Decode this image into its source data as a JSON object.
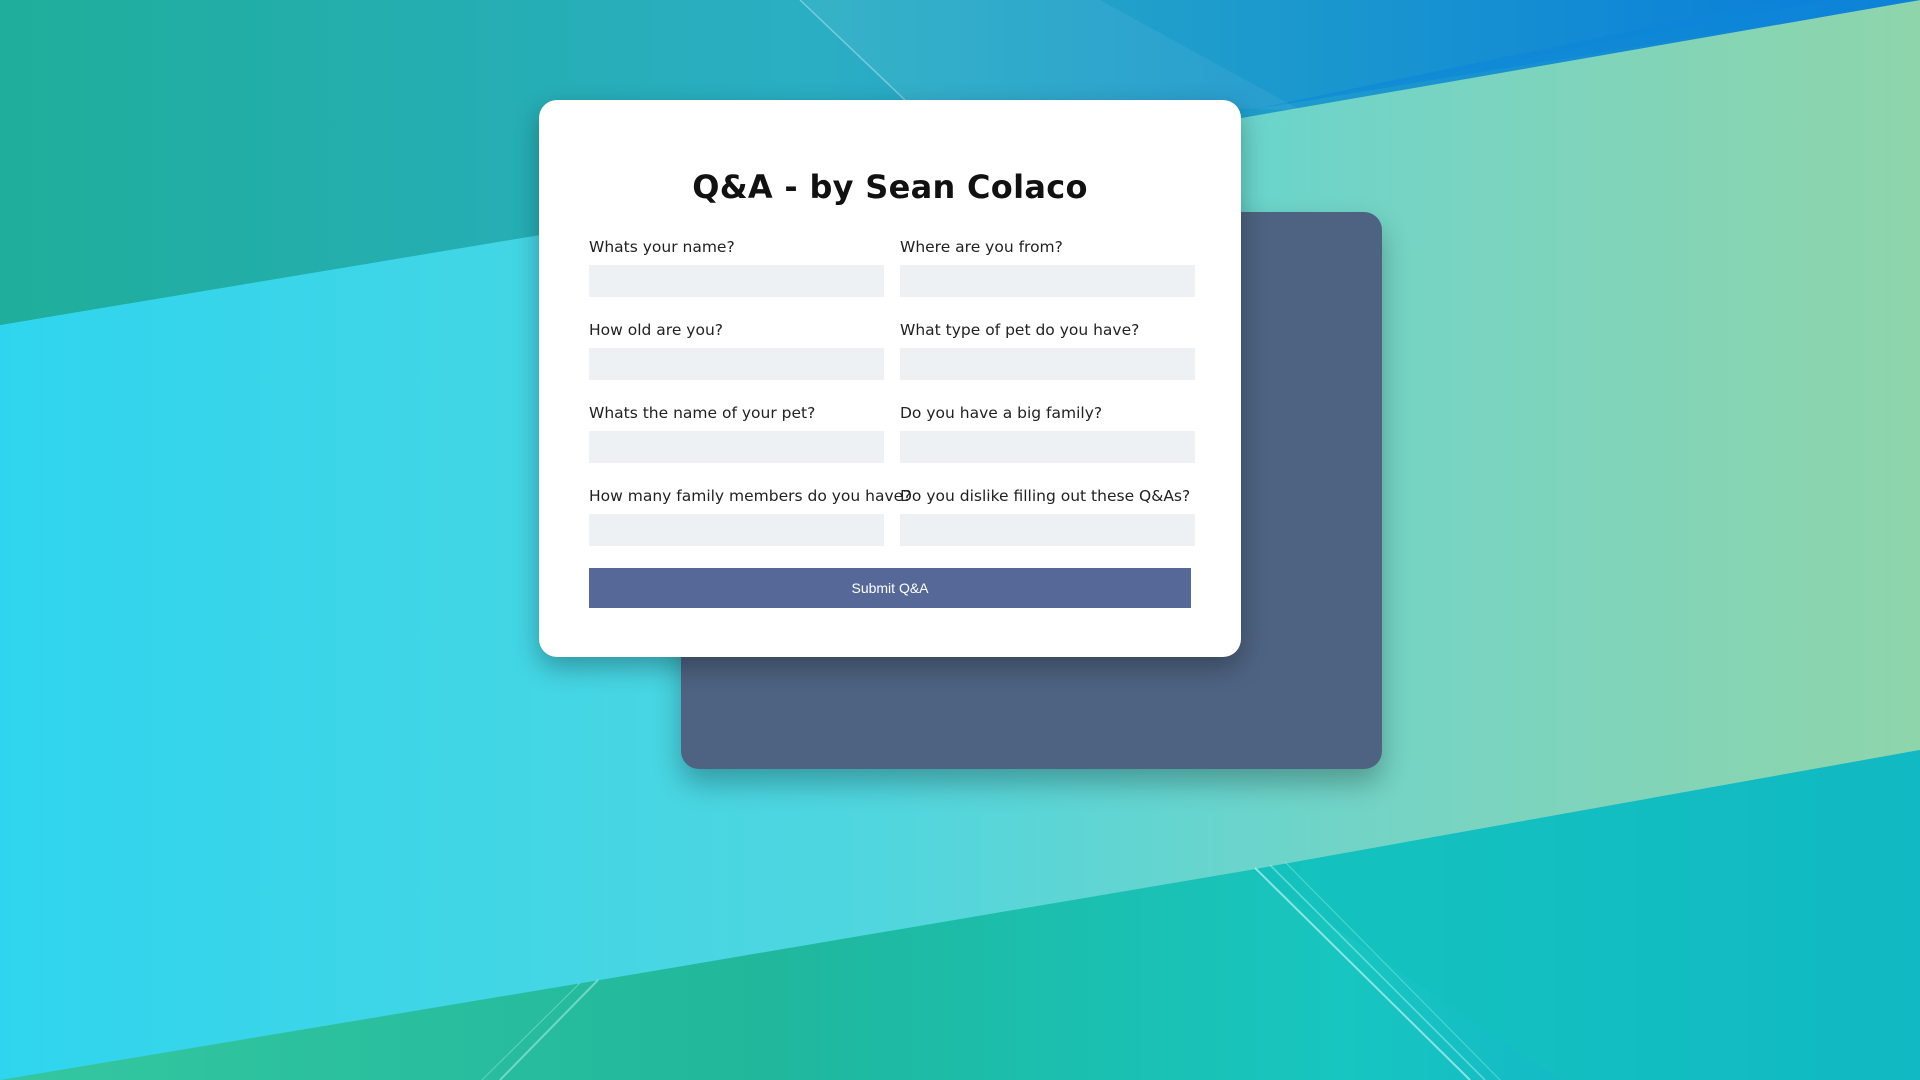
{
  "title": "Q&A - by Sean Colaco",
  "fields": [
    {
      "label": "Whats your name?",
      "value": ""
    },
    {
      "label": "Where are you from?",
      "value": ""
    },
    {
      "label": "How old are you?",
      "value": ""
    },
    {
      "label": "What type of pet do you have?",
      "value": ""
    },
    {
      "label": "Whats the name of your pet?",
      "value": ""
    },
    {
      "label": "Do you have a big family?",
      "value": ""
    },
    {
      "label": "How many family members do you have?",
      "value": ""
    },
    {
      "label": "Do you dislike filling out these Q&As?",
      "value": ""
    }
  ],
  "submit_label": "Submit Q&A",
  "colors": {
    "card_background": "#ffffff",
    "back_card": "#4e6382",
    "input_background": "#edf1f4",
    "button": "#566897",
    "button_text": "#ffffff"
  }
}
